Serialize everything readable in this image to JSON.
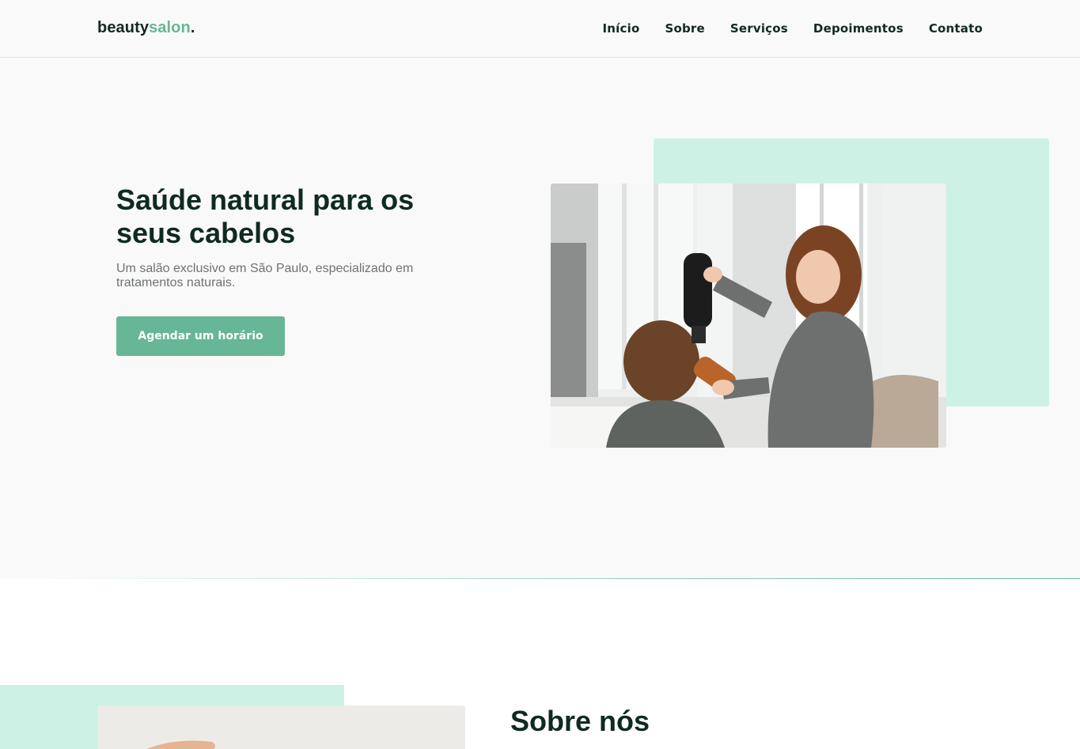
{
  "header": {
    "logo_main": "beauty",
    "logo_accent": "salon",
    "logo_dot": ".",
    "nav": [
      "Início",
      "Sobre",
      "Serviços",
      "Depoimentos",
      "Contato"
    ]
  },
  "hero": {
    "title": "Saúde natural para os seus cabelos",
    "subtitle": "Um salão exclusivo em São Paulo, especializado em tratamentos naturais.",
    "cta_label": "Agendar um horário",
    "image_icon": "salon-photo"
  },
  "about": {
    "title": "Sobre nós",
    "image_icon": "about-photo"
  },
  "colors": {
    "accent": "#67b696",
    "accent_light": "#cdf2e5",
    "text_dark": "#0f2a22",
    "text_muted": "#6e7371",
    "background": "#f9f9f9"
  }
}
